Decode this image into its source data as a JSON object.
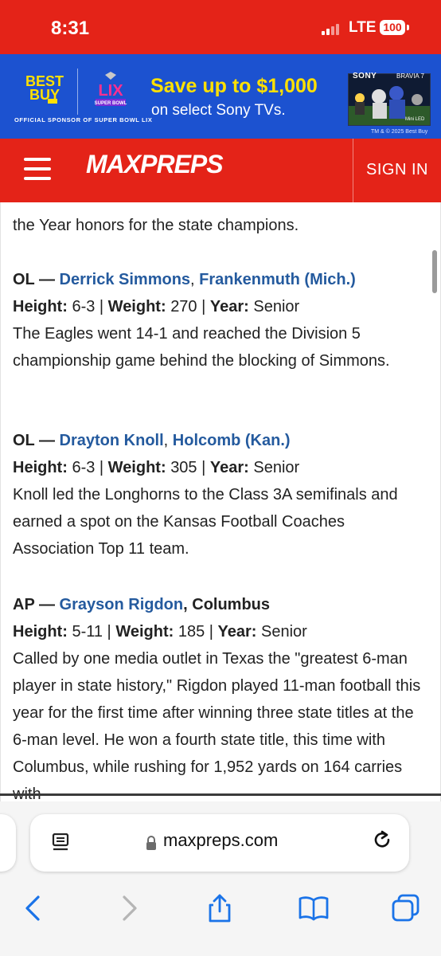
{
  "status_bar": {
    "time": "8:31",
    "network": "LTE",
    "battery": "100"
  },
  "ad": {
    "brand": "BEST BUY",
    "event_logo": "LIX",
    "event_sub": "SUPER BOWL",
    "sponsor_line": "OFFICIAL SPONSOR OF SUPER BOWL LIX",
    "headline": "Save up to $1,000",
    "subline": "on select Sony TVs.",
    "tv_brand": "SONY",
    "tv_model": "BRAVIA 7",
    "tv_badge": "Mini LED",
    "copyright": "TM & © 2025 Best Buy",
    "colors": {
      "background": "#1c52d0",
      "accent": "#ffe000"
    }
  },
  "nav": {
    "logo": "MAXPREPS",
    "sign_in": "SIGN IN",
    "color": "#e42318"
  },
  "article": {
    "fragment": "the Year honors for the state champions.",
    "entries": [
      {
        "position": "OL —",
        "player": "Derrick Simmons",
        "comma": ",",
        "school": "Frankenmuth (Mich.)",
        "height_label": "Height:",
        "height": "6-3",
        "weight_label": "Weight:",
        "weight": "270",
        "year_label": "Year:",
        "year": "Senior",
        "blurb": "The Eagles went 14-1 and reached the Division 5 championship game behind the blocking of Simmons."
      },
      {
        "position": "OL —",
        "player": "Drayton Knoll",
        "comma": ",",
        "school": "Holcomb (Kan.)",
        "height_label": "Height:",
        "height": "6-3",
        "weight_label": "Weight:",
        "weight": "305",
        "year_label": "Year:",
        "year": "Senior",
        "blurb": "Knoll led the Longhorns to the Class 3A semifinals and earned a spot on the Kansas Football Coaches Association Top 11 team."
      },
      {
        "position": "AP —",
        "player": "Grayson Rigdon",
        "comma": ",",
        "school": "Columbus",
        "height_label": "Height:",
        "height": "5-11",
        "weight_label": "Weight:",
        "weight": "185",
        "year_label": "Year:",
        "year": "Senior",
        "blurb": "Called by one media outlet in Texas the \"greatest 6-man player in state history,\" Rigdon played 11-man football this year for the first time after winning three state titles at the 6-man level. He won a fourth state title, this time with Columbus, while rushing for 1,952 yards on 164 carries with"
      }
    ],
    "separator": " | ",
    "link_color": "#245a9e"
  },
  "browser": {
    "domain": "maxpreps.com",
    "icons": [
      "reader-icon",
      "lock-icon",
      "reload-icon",
      "back-icon",
      "forward-icon",
      "share-icon",
      "bookmarks-icon",
      "tabs-icon"
    ]
  }
}
